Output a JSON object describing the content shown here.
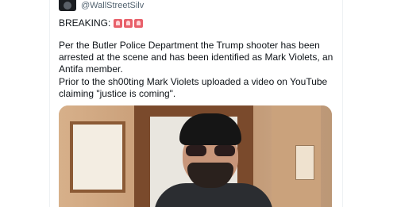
{
  "author": {
    "handle": "@WallStreetSilv",
    "avatar_icon": "avatar-image"
  },
  "tweet": {
    "breaking_label": "BREAKING:",
    "breaking_emoji": "siren-emoji",
    "paragraph1": "Per the Butler Police Department the Trump shooter has been arrested at the scene and has been identified as Mark Violets, an Antifa member.",
    "paragraph2": "Prior to the sh00ting Mark Violets uploaded a video on YouTube claiming \"justice is coming\"."
  },
  "media": {
    "type": "video-thumbnail"
  }
}
